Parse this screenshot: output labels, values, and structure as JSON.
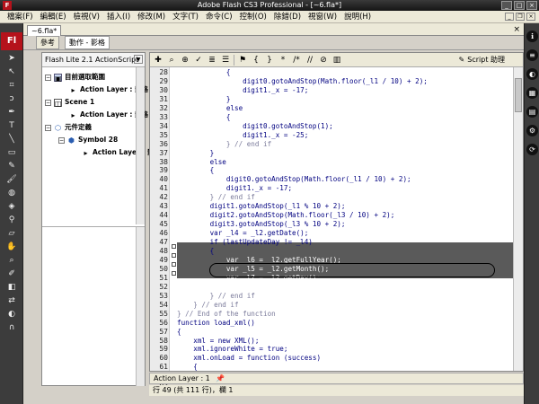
{
  "window": {
    "title": "Adobe Flash CS3 Professional - [~6.fla*]",
    "app_badge": "F"
  },
  "menu": [
    "檔案(F)",
    "編輯(E)",
    "檢視(V)",
    "插入(I)",
    "修改(M)",
    "文字(T)",
    "命令(C)",
    "控制(O)",
    "除錯(D)",
    "視窗(W)",
    "說明(H)"
  ],
  "doc_tab": "~6.fla*",
  "panel_tabs": [
    "參考",
    "動作 - 影格"
  ],
  "tools_logo": "Fl",
  "selector": "Flash Lite 2.1 ActionScript",
  "tree": [
    {
      "label": "目前選取範圍",
      "level": 0,
      "bold": true,
      "expander": "−"
    },
    {
      "label": "Action Layer : 影格",
      "level": 1,
      "bold": true
    },
    {
      "label": "Scene 1",
      "level": 0,
      "bold": true,
      "expander": "−"
    },
    {
      "label": "Action Layer : 影格",
      "level": 1,
      "bold": true
    },
    {
      "label": "元件定義",
      "level": 0,
      "bold": true,
      "expander": "−"
    },
    {
      "label": "Symbol 28",
      "level": 1,
      "bold": true,
      "expander": "−"
    },
    {
      "label": "Action Layer : 影格",
      "level": 2,
      "bold": true
    }
  ],
  "script_assist": "Script 助理",
  "line_numbers": [
    28,
    29,
    30,
    31,
    32,
    33,
    34,
    35,
    36,
    37,
    38,
    39,
    40,
    41,
    42,
    43,
    44,
    45,
    46,
    47,
    48,
    49,
    50,
    51,
    52,
    53,
    54,
    55,
    56,
    57,
    58,
    59,
    60,
    61,
    62,
    63
  ],
  "code_lines": [
    "            {",
    "                digit0.gotoAndStop(Math.floor(_l1 / 10) + 2);",
    "                digit1._x = -17;",
    "            }",
    "            else",
    "            {",
    "                digit0.gotoAndStop(1);",
    "                digit1._x = -25;",
    "            } // end if",
    "        }",
    "        else",
    "        {",
    "            digit0.gotoAndStop(Math.floor(_l1 / 10) + 2);",
    "            digit1._x = -17;",
    "        } // end if",
    "        digit1.gotoAndStop(_l1 % 10 + 2);",
    "        digit2.gotoAndStop(Math.floor(_l3 / 10) + 2);",
    "        digit3.gotoAndStop(_l3 % 10 + 2);",
    "        var _l4 = _l2.getDate();",
    "        if (lastUpdateDay != _l4)",
    "        {",
    "            var _l6 = _l2.getFullYear();",
    "            var _l5 = _l2.getMonth();",
    "            var _l7 = _l2.getDay();",
    "            fullDate.text = _l6 + \"年\" + months[_l5] + \"/\" + _l4 + \", \" + days[_l7];",
    "        } // end if",
    "    } // end if",
    "} // End of the function",
    "function load_xml()",
    "{",
    "    xml = new XML();",
    "    xml.ignoreWhite = true;",
    "    xml.onLoad = function (success)",
    "    {",
    "        if (success)",
    "        {"
  ],
  "layer_tab": "Action Layer : 1",
  "status": "行 49 (共 111 行)，欄 1"
}
